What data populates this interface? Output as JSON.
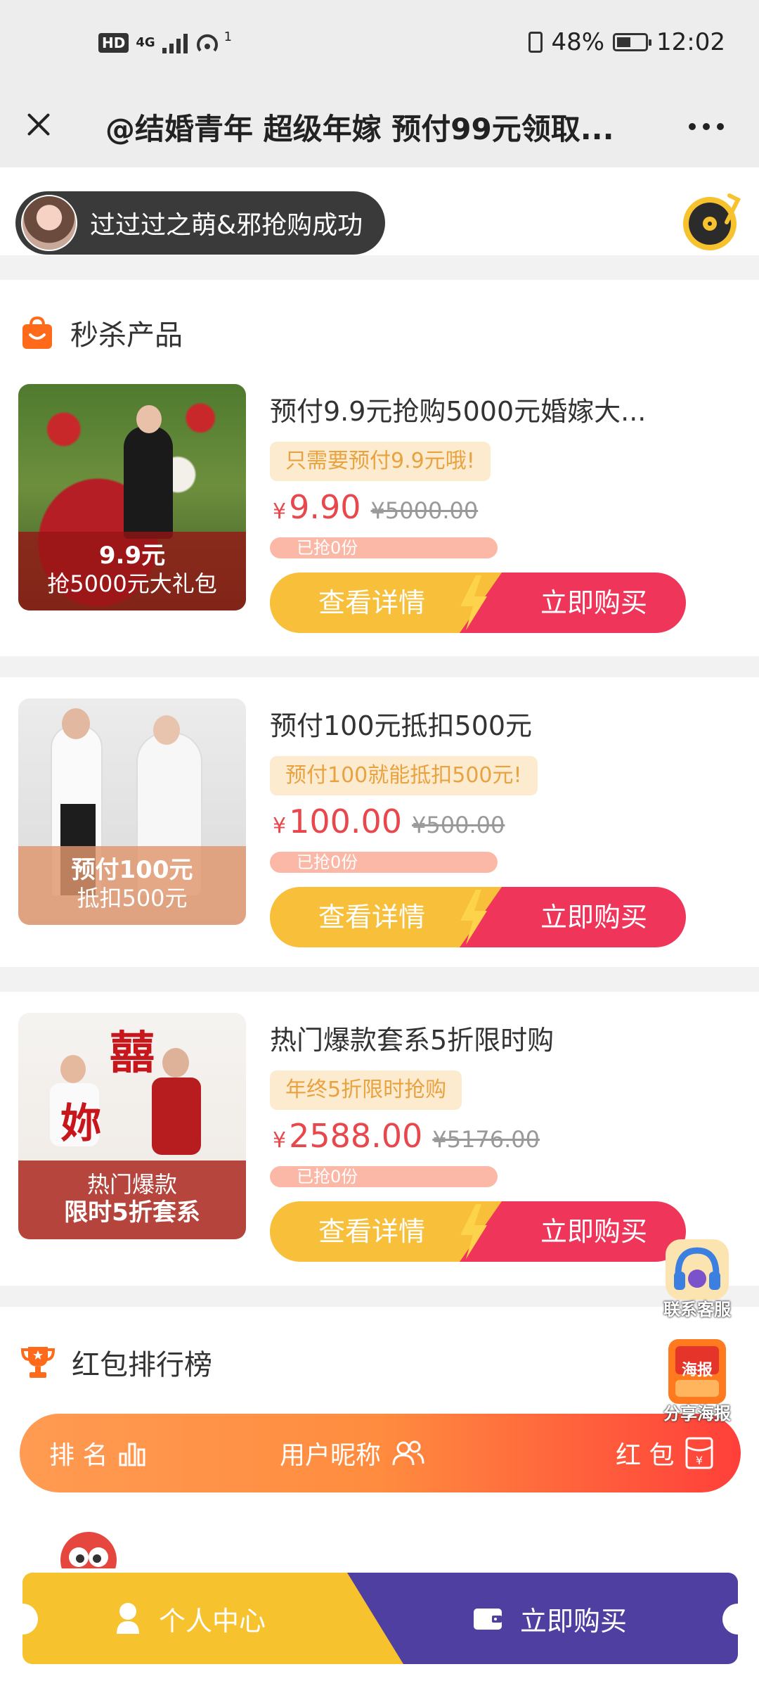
{
  "status_bar": {
    "hd": "HD",
    "network": "4G",
    "hotspot_count": "1",
    "battery": "48%",
    "time": "12:02"
  },
  "header": {
    "title": "@结婚青年 超级年嫁 预付99元领取..."
  },
  "notice": {
    "text": "过过过之萌&邪抢购成功"
  },
  "flash_sale": {
    "title": "秒杀产品",
    "products": [
      {
        "image_line1": "9.9元",
        "image_line2": "抢5000元大礼包",
        "title": "预付9.9元抢购5000元婚嫁大...",
        "tag": "只需要预付9.9元哦!",
        "currency": "¥",
        "price": "9.90",
        "original_price": "¥5000.00",
        "sold": "已抢0份",
        "detail_label": "查看详情",
        "buy_label": "立即购买"
      },
      {
        "image_line1": "预付100元",
        "image_line2": "抵扣500元",
        "title": "预付100元抵扣500元",
        "tag": "预付100就能抵扣500元!",
        "currency": "¥",
        "price": "100.00",
        "original_price": "¥500.00",
        "sold": "已抢0份",
        "detail_label": "查看详情",
        "buy_label": "立即购买"
      },
      {
        "image_line1": "热门爆款",
        "image_line2": "限时5折套系",
        "title": "热门爆款套系5折限时购",
        "tag": "年终5折限时抢购",
        "currency": "¥",
        "price": "2588.00",
        "original_price": "¥5176.00",
        "sold": "已抢0份",
        "detail_label": "查看详情",
        "buy_label": "立即购买"
      }
    ]
  },
  "ranking": {
    "title": "红包排行榜",
    "col_rank": "排 名",
    "col_user": "用户昵称",
    "col_packet": "红 包"
  },
  "floating": {
    "service_label": "联系客服",
    "poster_badge": "海报",
    "poster_label": "分享海报"
  },
  "bottom_nav": {
    "personal_center": "个人中心",
    "buy_now": "立即购买"
  },
  "colors": {
    "price_red": "#e8484c",
    "detail_yellow": "#f7bf3a",
    "buy_pink": "#f0355a",
    "nav_purple": "#4e3fa0",
    "rank_orange": "#ff8c3f"
  }
}
